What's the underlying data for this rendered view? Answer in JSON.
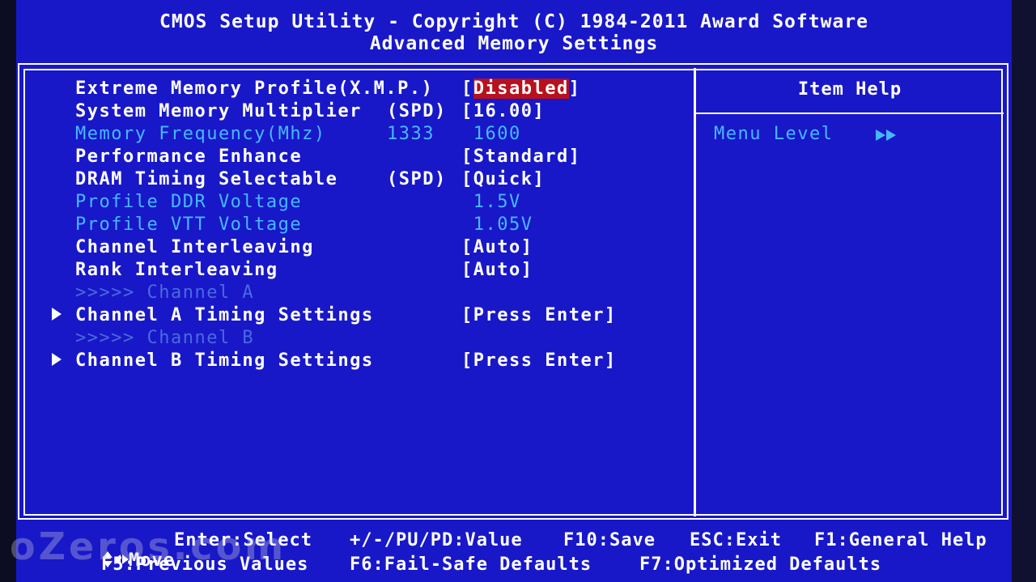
{
  "header": {
    "line1": "CMOS Setup Utility - Copyright (C) 1984-2011 Award Software",
    "line2": "Advanced Memory Settings"
  },
  "items": [
    {
      "label": "Extreme Memory Profile(X.M.P.)",
      "mid": "",
      "value_prefix": "[",
      "value": "Disabled",
      "value_suffix": "]",
      "state": "selected"
    },
    {
      "label": "System Memory Multiplier",
      "mid": "(SPD)",
      "value_prefix": "",
      "value": "[16.00]",
      "value_suffix": "",
      "state": "normal"
    },
    {
      "label": "Memory Frequency(Mhz)",
      "mid": "1333",
      "value_prefix": "",
      "value": " 1600",
      "value_suffix": "",
      "state": "dim"
    },
    {
      "label": "Performance Enhance",
      "mid": "",
      "value_prefix": "",
      "value": "[Standard]",
      "value_suffix": "",
      "state": "normal"
    },
    {
      "label": "DRAM Timing Selectable",
      "mid": "(SPD)",
      "value_prefix": "",
      "value": "[Quick]",
      "value_suffix": "",
      "state": "normal"
    },
    {
      "label": "Profile DDR Voltage",
      "mid": "",
      "value_prefix": "",
      "value": " 1.5V",
      "value_suffix": "",
      "state": "dim"
    },
    {
      "label": "Profile VTT Voltage",
      "mid": "",
      "value_prefix": "",
      "value": " 1.05V",
      "value_suffix": "",
      "state": "dim"
    },
    {
      "label": "Channel Interleaving",
      "mid": "",
      "value_prefix": "",
      "value": "[Auto]",
      "value_suffix": "",
      "state": "normal"
    },
    {
      "label": "Rank Interleaving",
      "mid": "",
      "value_prefix": "",
      "value": "[Auto]",
      "value_suffix": "",
      "state": "normal"
    },
    {
      "label": ">>>>> Channel A",
      "mid": "",
      "value_prefix": "",
      "value": "",
      "value_suffix": "",
      "state": "separator"
    },
    {
      "label": "Channel A Timing Settings",
      "mid": "",
      "value_prefix": "",
      "value": "[Press Enter]",
      "value_suffix": "",
      "state": "submenu"
    },
    {
      "label": ">>>>> Channel B",
      "mid": "",
      "value_prefix": "",
      "value": "",
      "value_suffix": "",
      "state": "separator"
    },
    {
      "label": "Channel B Timing Settings",
      "mid": "",
      "value_prefix": "",
      "value": "[Press Enter]",
      "value_suffix": "",
      "state": "submenu"
    }
  ],
  "help": {
    "title": "Item Help",
    "menu_level_label": "Menu Level",
    "menu_level_icon": "double-triangle-right-icon"
  },
  "footer": {
    "move": "Move",
    "enter_select": "Enter:Select",
    "value": "+/-/PU/PD:Value",
    "save": "F10:Save",
    "exit": "ESC:Exit",
    "help": "F1:General Help",
    "prev": "F5:Previous Values",
    "failsafe": "F6:Fail-Safe Defaults",
    "optimized": "F7:Optimized Defaults"
  },
  "watermark": "oZeros.com",
  "colors": {
    "background": "#1818c8",
    "highlight": "#b8101c",
    "dim_text": "#48b8ff",
    "separator_text": "#4a6ae0"
  }
}
